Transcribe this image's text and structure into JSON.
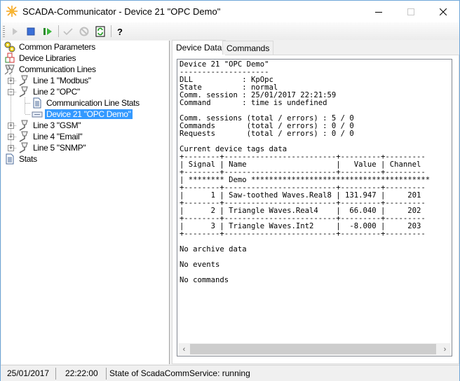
{
  "window": {
    "title": "SCADA-Communicator - Device 21 \"OPC Demo\"",
    "app_icon": "sun-icon"
  },
  "toolbar": {
    "buttons": [
      {
        "name": "start-icon",
        "enabled": false
      },
      {
        "name": "stop-icon",
        "enabled": true
      },
      {
        "name": "restart-icon",
        "enabled": true
      },
      {
        "name": "apply-icon",
        "enabled": false
      },
      {
        "name": "cancel-icon",
        "enabled": false
      },
      {
        "name": "refresh-icon",
        "enabled": true
      },
      {
        "name": "help-icon",
        "enabled": true
      }
    ]
  },
  "tree": {
    "common_parameters": "Common Parameters",
    "device_libraries": "Device Libraries",
    "communication_lines": "Communication Lines",
    "lines": [
      {
        "label": "Line 1 \"Modbus\"",
        "expanded": false
      },
      {
        "label": "Line 2 \"OPC\"",
        "expanded": true,
        "children": [
          {
            "label": "Communication Line Stats"
          },
          {
            "label": "Device 21 \"OPC Demo\"",
            "selected": true
          }
        ]
      },
      {
        "label": "Line 3 \"GSM\"",
        "expanded": false
      },
      {
        "label": "Line 4 \"Email\"",
        "expanded": false
      },
      {
        "label": "Line 5 \"SNMP\"",
        "expanded": false
      }
    ],
    "stats": "Stats"
  },
  "tabs": [
    {
      "label": "Device Data",
      "active": true
    },
    {
      "label": "Commands",
      "active": false
    }
  ],
  "device_data": {
    "header": "Device 21 \"OPC Demo\"",
    "underline": "--------------------",
    "props": [
      {
        "key": "DLL          ",
        "value": "KpOpc"
      },
      {
        "key": "State        ",
        "value": "normal"
      },
      {
        "key": "Comm. session",
        "value": "25/01/2017 22:21:59"
      },
      {
        "key": "Command      ",
        "value": "time is undefined"
      }
    ],
    "counters": [
      {
        "key": "Comm. sessions",
        "total": "5",
        "errors": "0"
      },
      {
        "key": "Commands      ",
        "total": "0",
        "errors": "0"
      },
      {
        "key": "Requests      ",
        "total": "0",
        "errors": "0"
      }
    ],
    "counters_suffix": "(total / errors)",
    "tags_title": "Current device tags data",
    "tags_columns": [
      "Signal",
      "Name",
      "Value",
      "Channel"
    ],
    "tags_group": "******** Demo ****************************************",
    "tags_rows": [
      {
        "signal": "1",
        "name": "Saw-toothed Waves.Real8",
        "value": "131.947",
        "channel": "201"
      },
      {
        "signal": "2",
        "name": "Triangle Waves.Real4",
        "value": "66.040",
        "channel": "202"
      },
      {
        "signal": "3",
        "name": "Triangle Waves.Int2",
        "value": "-8.000",
        "channel": "203"
      }
    ],
    "no_archive": "No archive data",
    "no_events": "No events",
    "no_commands": "No commands"
  },
  "status_bar": {
    "date": "25/01/2017",
    "time": "22:22:00",
    "service_state": "State of ScadaCommService: running"
  }
}
